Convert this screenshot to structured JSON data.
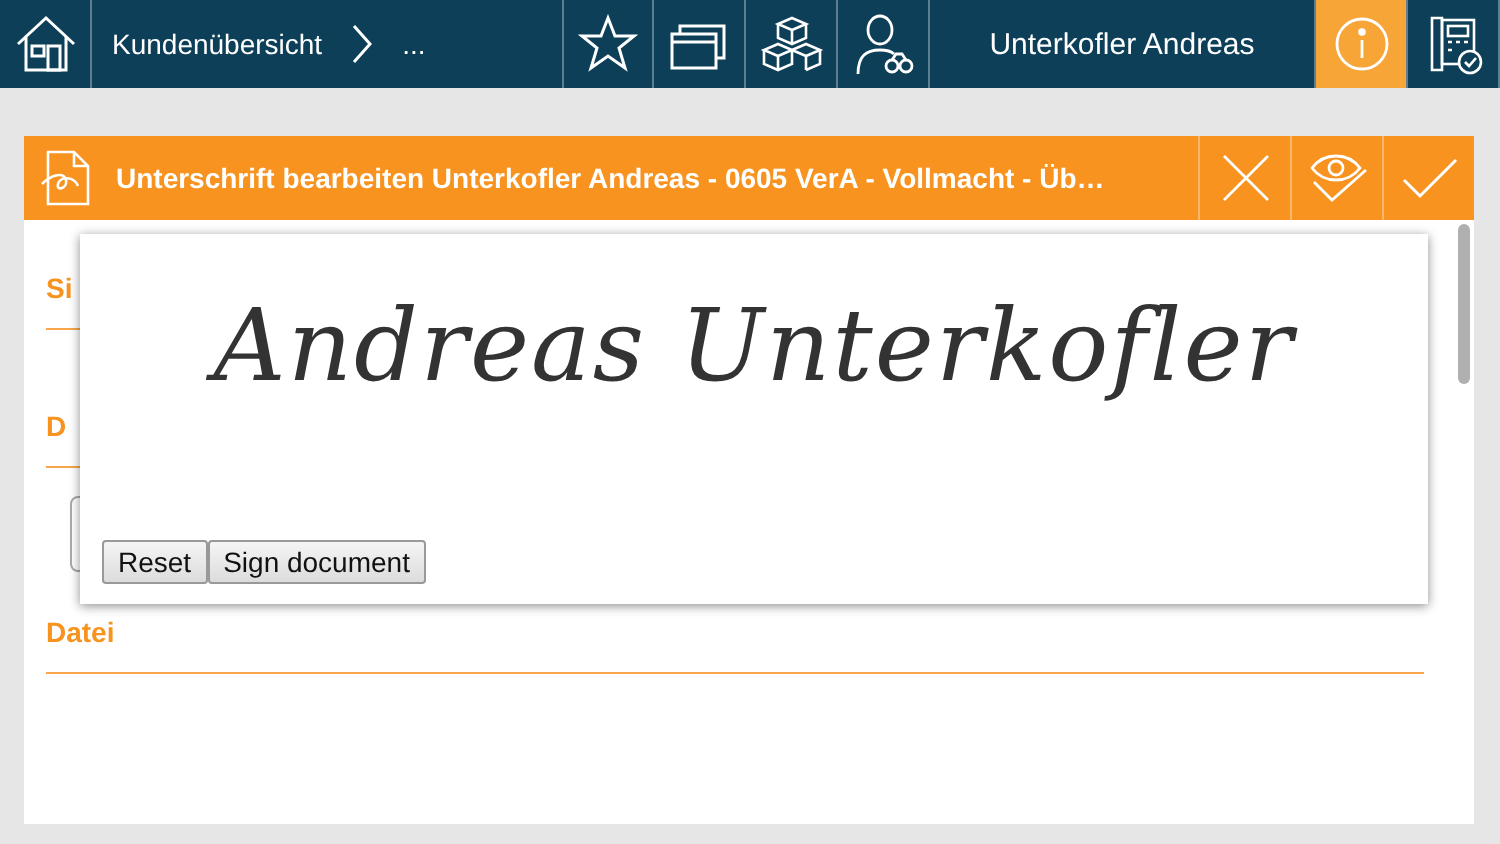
{
  "top_bar": {
    "breadcrumb": [
      "Kundenübersicht",
      "..."
    ],
    "customer": "Unterkofler Andreas",
    "info_active": true
  },
  "dialog": {
    "title": "Unterschrift bearbeiten Unterkofler Andreas - 0605 VerA - Vollmacht - Üb…"
  },
  "form": {
    "sections": [
      {
        "label": "Si"
      },
      {
        "label": "D",
        "field": true
      },
      {
        "label": "Datei"
      }
    ]
  },
  "signature_pad": {
    "signature": "Andreas Unterkofler",
    "buttons": [
      "Reset",
      "Sign document"
    ]
  }
}
